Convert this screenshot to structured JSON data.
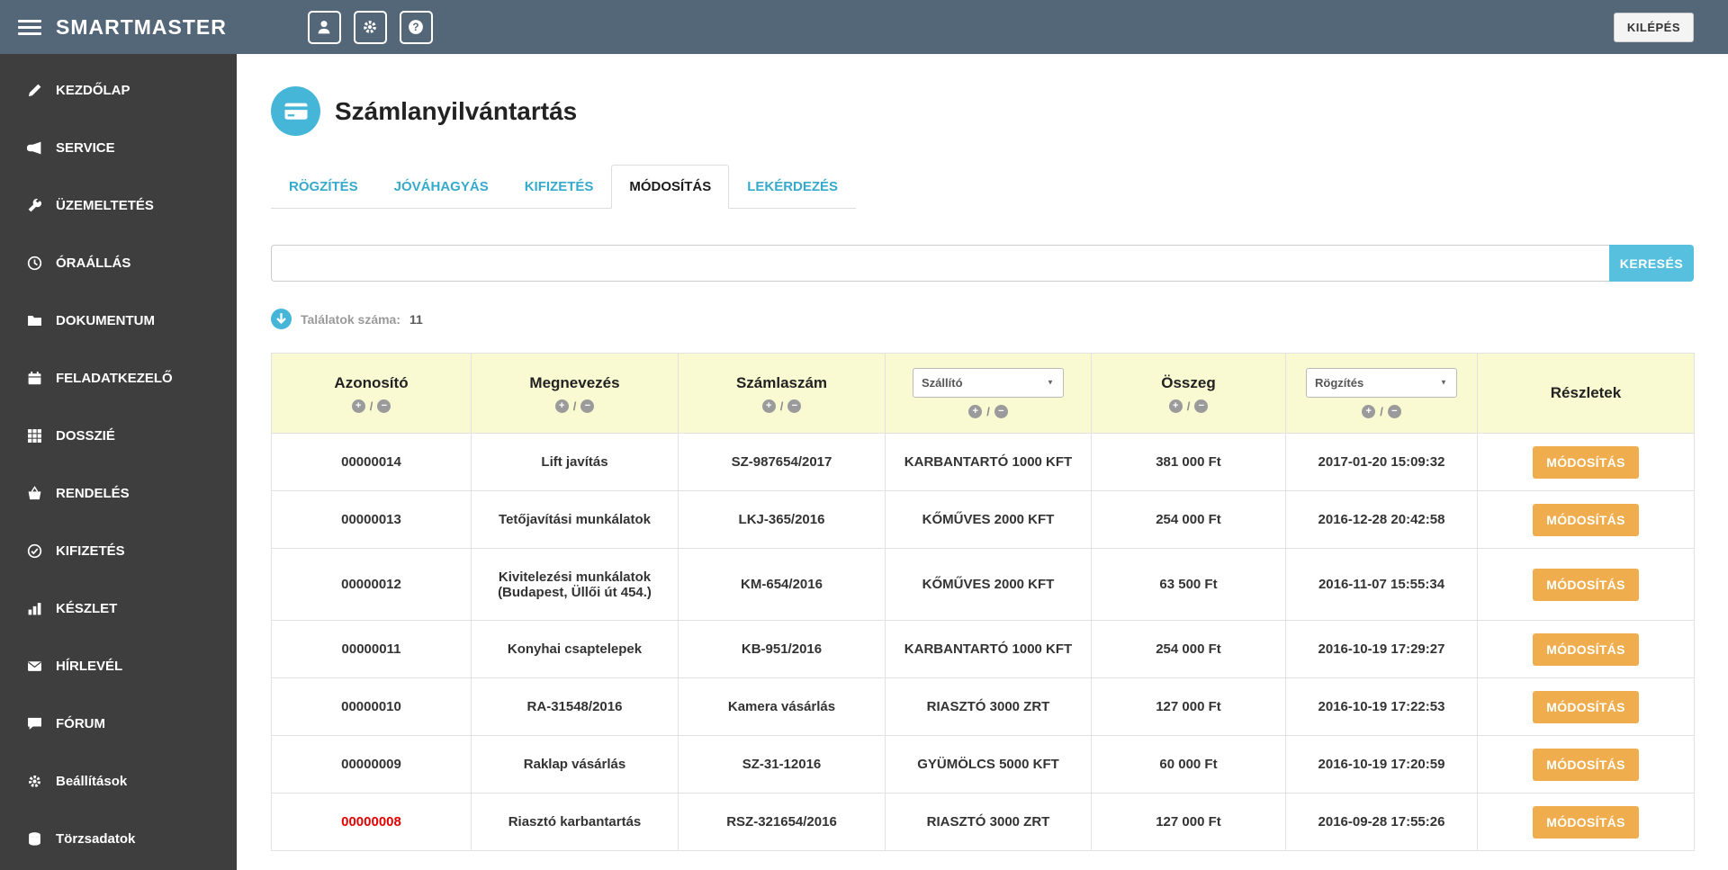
{
  "theme": {
    "topbar_bg": "#546779",
    "sidebar_bg": "#3e3e3e",
    "accent_blue": "#45b6d8",
    "tab_link_blue": "#35aacd",
    "search_button_blue": "#56c0de",
    "header_yellow": "#f9f9d2",
    "action_orange": "#f0ad4e",
    "alert_red": "#e20000"
  },
  "topbar": {
    "brand": "SMARTMASTER",
    "exit_label": "KILÉPÉS",
    "icons": [
      "user-icon",
      "gear-icon",
      "help-icon"
    ]
  },
  "sidebar": {
    "items": [
      {
        "label": "KEZDŐLAP",
        "icon": "pencil-icon"
      },
      {
        "label": "SERVICE",
        "icon": "megaphone-icon"
      },
      {
        "label": "ÜZEMELTETÉS",
        "icon": "wrench-icon"
      },
      {
        "label": "ÓRAÁLLÁS",
        "icon": "clock-icon"
      },
      {
        "label": "DOKUMENTUM",
        "icon": "folder-icon"
      },
      {
        "label": "FELADATKEZELŐ",
        "icon": "calendar-icon"
      },
      {
        "label": "DOSSZIÉ",
        "icon": "grid-icon"
      },
      {
        "label": "RENDELÉS",
        "icon": "basket-icon"
      },
      {
        "label": "KIFIZETÉS",
        "icon": "check-circle-icon"
      },
      {
        "label": "KÉSZLET",
        "icon": "bar-chart-icon"
      },
      {
        "label": "HÍRLEVÉL",
        "icon": "envelope-icon"
      },
      {
        "label": "FÓRUM",
        "icon": "comment-icon"
      },
      {
        "label": "Beállítások",
        "icon": "gear-icon"
      },
      {
        "label": "Törzsadatok",
        "icon": "database-icon"
      }
    ]
  },
  "page": {
    "title": "Számlanyilvántartás",
    "tabs": [
      {
        "label": "RÖGZÍTÉS",
        "active": false
      },
      {
        "label": "JÓVÁHAGYÁS",
        "active": false
      },
      {
        "label": "KIFIZETÉS",
        "active": false
      },
      {
        "label": "MÓDOSÍTÁS",
        "active": true
      },
      {
        "label": "LEKÉRDEZÉS",
        "active": false
      }
    ],
    "search": {
      "value": "",
      "button_label": "KERESÉS"
    },
    "results_label": "Találatok száma:",
    "results_count": "11"
  },
  "table": {
    "columns": {
      "azonosito": "Azonosító",
      "megnevezes": "Megnevezés",
      "szamlaszam": "Számlaszám",
      "szallito": "Szállító",
      "osszeg": "Összeg",
      "rogzites": "Rögzítés",
      "reszletek": "Részletek"
    },
    "filters": {
      "szallito_selected": "Szállító",
      "rogzites_selected": "Rögzítés"
    },
    "action_label": "MÓDOSÍTÁS",
    "rows": [
      {
        "id": "00000014",
        "name": "Lift javítás",
        "invoice": "SZ-987654/2017",
        "supplier": "KARBANTARTÓ 1000 KFT",
        "amount": "381 000 Ft",
        "date": "2017-01-20 15:09:32",
        "highlight": false
      },
      {
        "id": "00000013",
        "name": "Tetőjavítási munkálatok",
        "invoice": "LKJ-365/2016",
        "supplier": "KŐMŰVES 2000 KFT",
        "amount": "254 000 Ft",
        "date": "2016-12-28 20:42:58",
        "highlight": false
      },
      {
        "id": "00000012",
        "name": "Kivitelezési munkálatok (Budapest, Üllői út 454.)",
        "invoice": "KM-654/2016",
        "supplier": "KŐMŰVES 2000 KFT",
        "amount": "63 500 Ft",
        "date": "2016-11-07 15:55:34",
        "highlight": false
      },
      {
        "id": "00000011",
        "name": "Konyhai csaptelepek",
        "invoice": "KB-951/2016",
        "supplier": "KARBANTARTÓ 1000 KFT",
        "amount": "254 000 Ft",
        "date": "2016-10-19 17:29:27",
        "highlight": false
      },
      {
        "id": "00000010",
        "name": "RA-31548/2016",
        "invoice": "Kamera vásárlás",
        "supplier": "RIASZTÓ 3000 ZRT",
        "amount": "127 000 Ft",
        "date": "2016-10-19 17:22:53",
        "highlight": false
      },
      {
        "id": "00000009",
        "name": "Raklap vásárlás",
        "invoice": "SZ-31-12016",
        "supplier": "GYÜMÖLCS 5000 KFT",
        "amount": "60 000 Ft",
        "date": "2016-10-19 17:20:59",
        "highlight": false
      },
      {
        "id": "00000008",
        "name": "Riasztó karbantartás",
        "invoice": "RSZ-321654/2016",
        "supplier": "RIASZTÓ 3000 ZRT",
        "amount": "127 000 Ft",
        "date": "2016-09-28 17:55:26",
        "highlight": true
      }
    ]
  }
}
